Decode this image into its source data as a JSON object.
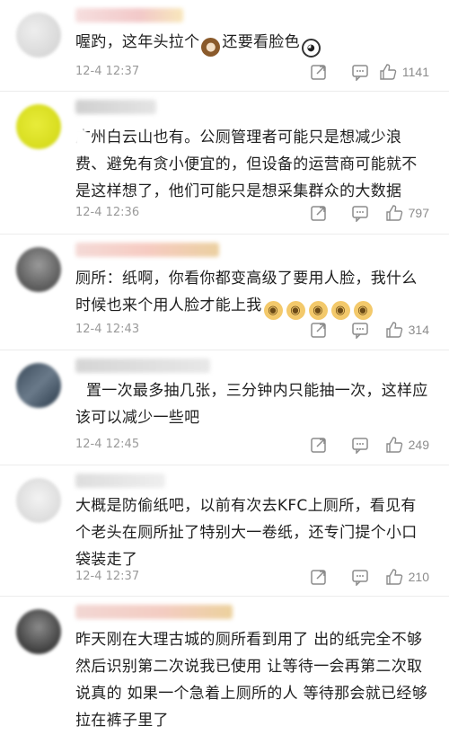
{
  "comments": [
    {
      "text": "喔趵，这年头拉个",
      "text_after": "还要看脸色",
      "time": "12-4 12:37",
      "likes": "1141",
      "emojis": [
        "poop",
        "panda"
      ]
    },
    {
      "text": "广州白云山也有。公厕管理者可能只是想减少浪费、避免有贪小便宜的，但设备的运营商可能就不是这样想了，他们可能只是想采集群众的大数据",
      "time": "12-4 12:36",
      "likes": "797"
    },
    {
      "text": "厕所：纸啊，你看你都变高级了要用人脸，我什么时候也来个用人脸才能上我",
      "time": "12-4 12:43",
      "likes": "314",
      "emojis": [
        "doge",
        "doge",
        "doge",
        "doge",
        "doge"
      ]
    },
    {
      "text": "置一次最多抽几张，三分钟内只能抽一次，这样应该可以减少一些吧",
      "time": "12-4 12:45",
      "likes": "249"
    },
    {
      "text": "大概是防偷纸吧，以前有次去KFC上厕所，看见有个老头在厕所扯了特别大一卷纸，还专门提个小口袋装走了",
      "time": "12-4 12:37",
      "likes": "210"
    },
    {
      "text": "昨天刚在大理古城的厕所看到用了 出的纸完全不够 然后识别第二次说我已使用 让等待一会再第二次取 说真的 如果一个急着上厕所的人 等待那会就已经够拉在裤子里了"
    }
  ],
  "icons": {
    "share": "share-icon",
    "reply": "reply-icon",
    "like": "thumb-up-icon",
    "emoji_poop": "poop-emoji",
    "emoji_panda": "panda-emoji",
    "emoji_doge": "doge-emoji"
  }
}
